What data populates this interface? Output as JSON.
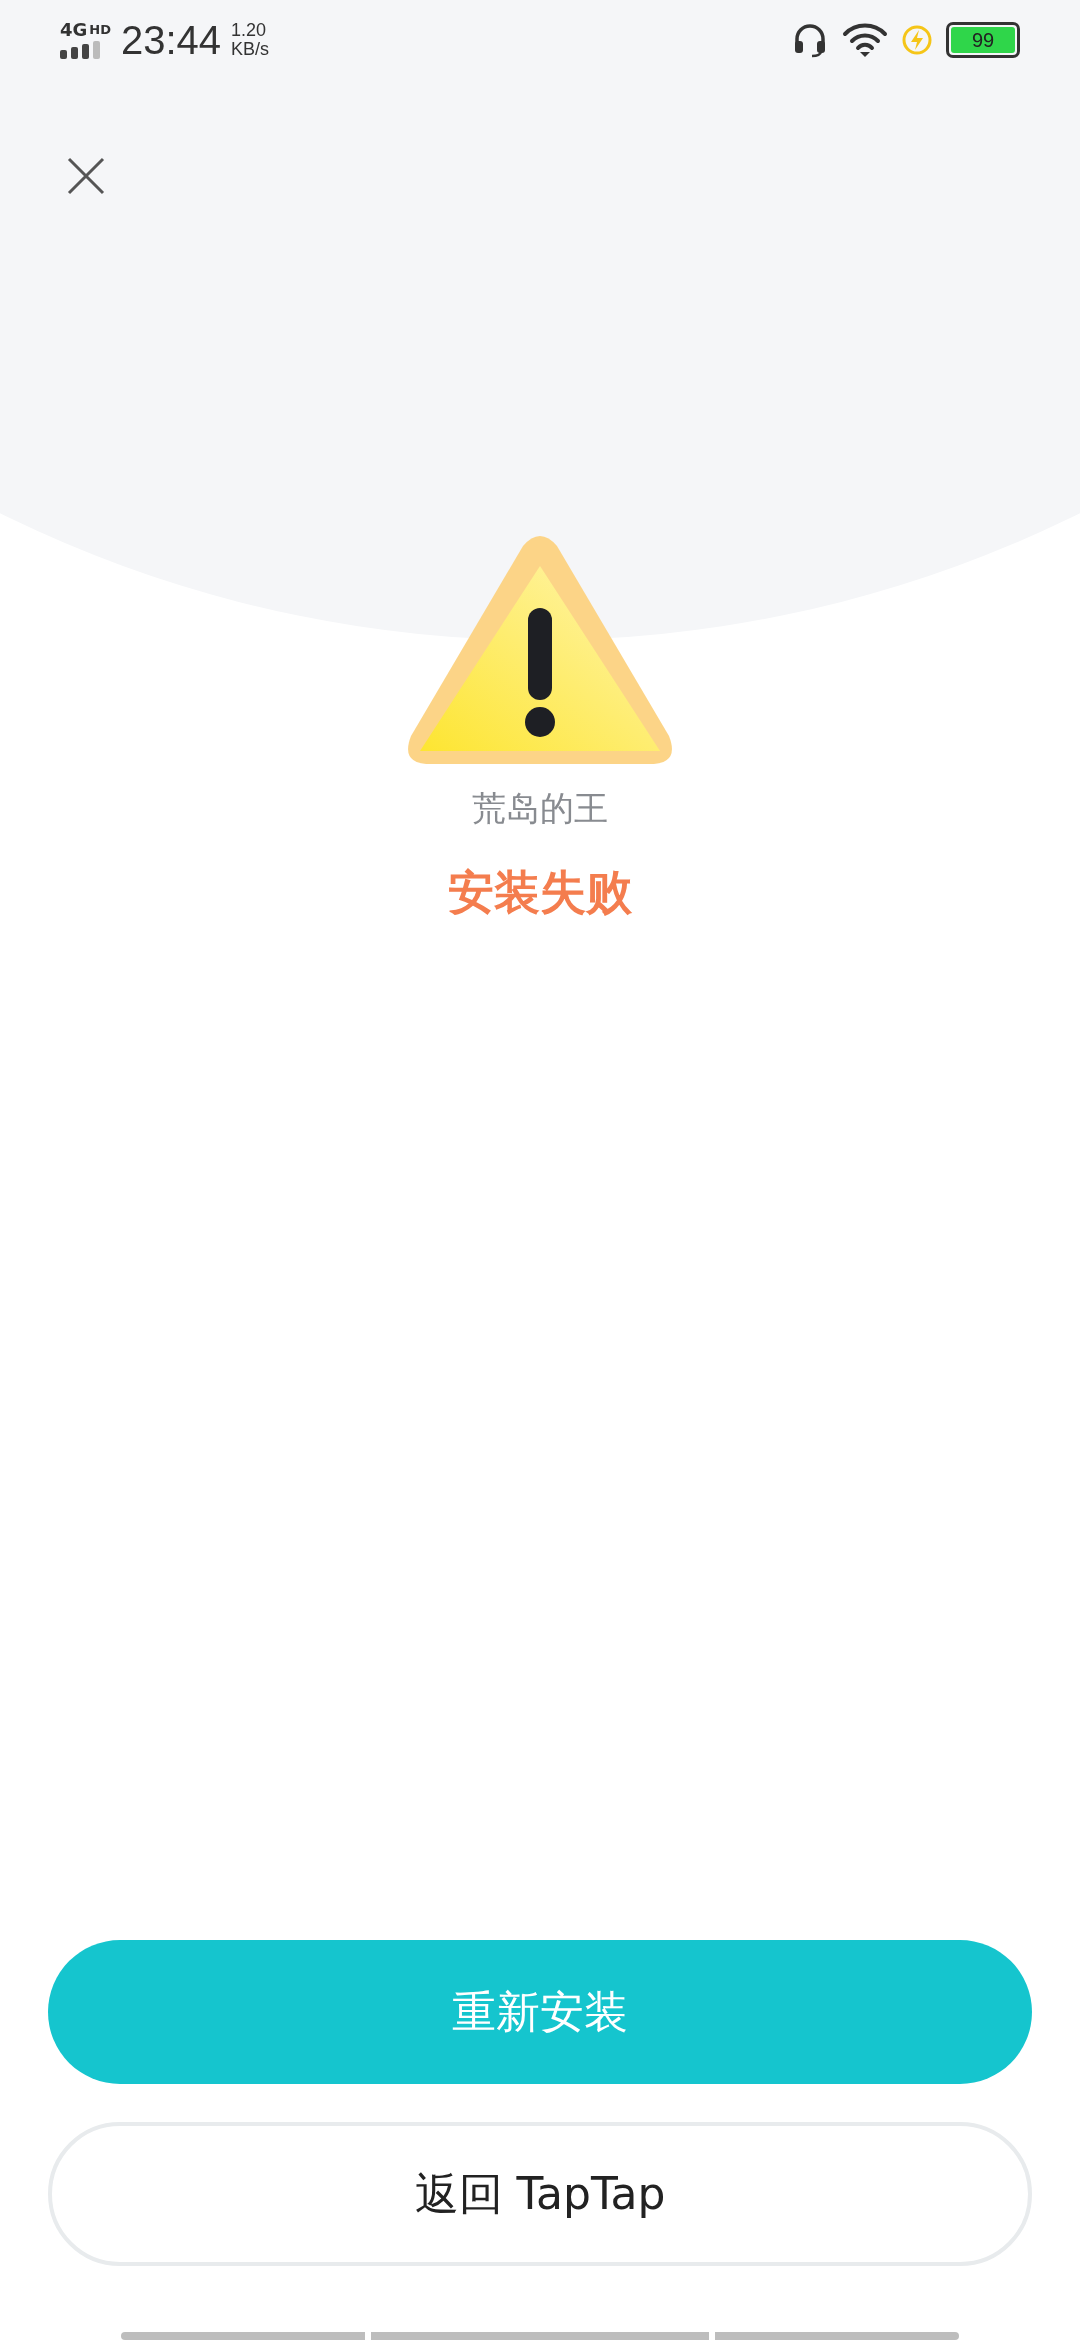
{
  "status_bar": {
    "network": "4G",
    "network_badge": "HD",
    "time": "23:44",
    "speed": "1.20",
    "speed_unit": "KB/s",
    "battery": "99"
  },
  "app_name": "荒岛的王",
  "status_message": "安装失败",
  "buttons": [
    {
      "label": "重新安装",
      "kind": "primary"
    },
    {
      "label": "返回 TapTap",
      "kind": "secondary"
    }
  ]
}
